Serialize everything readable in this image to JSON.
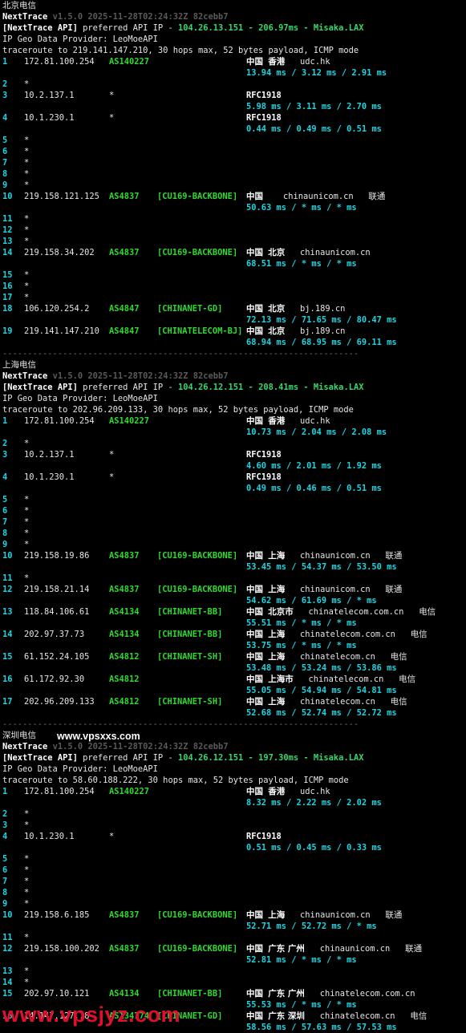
{
  "sections": [
    {
      "name": "北京电信",
      "version_line": {
        "tool": "NextTrace",
        "meta": "v1.5.0 2025-11-28T02:24:32Z 82cebb7"
      },
      "api_line": {
        "prefix": "[NextTrace API]",
        "mid": " preferred API IP - ",
        "ip": "104.26.13.151",
        "dash1": " - ",
        "latency": "206.97ms",
        "dash2": " - ",
        "node": "Misaka.LAX"
      },
      "geo_line": "IP Geo Data Provider: LeoMoeAPI",
      "trace_line": "traceroute to 219.141.147.210, 30 hops max, 52 bytes payload, ICMP mode",
      "rows": [
        {
          "hop": "1",
          "ip": "172.81.100.254",
          "asn": "AS140227",
          "tag": "",
          "country": "中国",
          "region": "香港",
          "city": "",
          "domain": "udc.hk",
          "isp": "",
          "times": "13.94 ms / 3.12 ms / 2.91 ms"
        },
        {
          "hop": "2",
          "ip": "*"
        },
        {
          "hop": "3",
          "ip": "10.2.137.1",
          "asn": "*",
          "tag": "",
          "country": "RFC1918",
          "times": "5.98 ms / 3.11 ms / 2.70 ms"
        },
        {
          "hop": "4",
          "ip": "10.1.230.1",
          "asn": "*",
          "tag": "",
          "country": "RFC1918",
          "times": "0.44 ms / 0.49 ms / 0.51 ms"
        },
        {
          "hop": "5",
          "ip": "*"
        },
        {
          "hop": "6",
          "ip": "*"
        },
        {
          "hop": "7",
          "ip": "*"
        },
        {
          "hop": "8",
          "ip": "*"
        },
        {
          "hop": "9",
          "ip": "*"
        },
        {
          "hop": "10",
          "ip": "219.158.121.125",
          "asn": "AS4837",
          "tag": "[CU169-BACKBONE]",
          "country": "中国",
          "region": "",
          "domain": "chinaunicom.cn",
          "isp": "联通",
          "times": "50.63 ms / * ms / * ms"
        },
        {
          "hop": "11",
          "ip": "*"
        },
        {
          "hop": "12",
          "ip": "*"
        },
        {
          "hop": "13",
          "ip": "*"
        },
        {
          "hop": "14",
          "ip": "219.158.34.202",
          "asn": "AS4837",
          "tag": "[CU169-BACKBONE]",
          "country": "中国",
          "region": "北京",
          "domain": "chinaunicom.cn",
          "isp": "",
          "times": "68.51 ms / * ms / * ms"
        },
        {
          "hop": "15",
          "ip": "*"
        },
        {
          "hop": "16",
          "ip": "*"
        },
        {
          "hop": "17",
          "ip": "*"
        },
        {
          "hop": "18",
          "ip": "106.120.254.2",
          "asn": "AS4847",
          "tag": "[CHINANET-GD]",
          "country": "中国",
          "region": "北京",
          "domain": "bj.189.cn",
          "isp": "",
          "times": "72.13 ms / 71.65 ms / 80.47 ms"
        },
        {
          "hop": "19",
          "ip": "219.141.147.210",
          "asn": "AS4847",
          "tag": "[CHINATELECOM-BJ]",
          "country": "中国",
          "region": "北京",
          "domain": "bj.189.cn",
          "isp": "",
          "times": "68.94 ms / 68.95 ms / 69.11 ms"
        }
      ]
    },
    {
      "name": "上海电信",
      "version_line": {
        "tool": "NextTrace",
        "meta": "v1.5.0 2025-11-28T02:24:32Z 82cebb7"
      },
      "api_line": {
        "prefix": "[NextTrace API]",
        "mid": " preferred API IP - ",
        "ip": "104.26.12.151",
        "dash1": " - ",
        "latency": "208.41ms",
        "dash2": " - ",
        "node": "Misaka.LAX"
      },
      "geo_line": "IP Geo Data Provider: LeoMoeAPI",
      "trace_line": "traceroute to 202.96.209.133, 30 hops max, 52 bytes payload, ICMP mode",
      "rows": [
        {
          "hop": "1",
          "ip": "172.81.100.254",
          "asn": "AS140227",
          "tag": "",
          "country": "中国",
          "region": "香港",
          "domain": "udc.hk",
          "isp": "",
          "times": "10.73 ms / 2.04 ms / 2.08 ms"
        },
        {
          "hop": "2",
          "ip": "*"
        },
        {
          "hop": "3",
          "ip": "10.2.137.1",
          "asn": "*",
          "tag": "",
          "country": "RFC1918",
          "times": "4.60 ms / 2.01 ms / 1.92 ms"
        },
        {
          "hop": "4",
          "ip": "10.1.230.1",
          "asn": "*",
          "tag": "",
          "country": "RFC1918",
          "times": "0.49 ms / 0.46 ms / 0.51 ms"
        },
        {
          "hop": "5",
          "ip": "*"
        },
        {
          "hop": "6",
          "ip": "*"
        },
        {
          "hop": "7",
          "ip": "*"
        },
        {
          "hop": "8",
          "ip": "*"
        },
        {
          "hop": "9",
          "ip": "*"
        },
        {
          "hop": "10",
          "ip": "219.158.19.86",
          "asn": "AS4837",
          "tag": "[CU169-BACKBONE]",
          "country": "中国",
          "region": "上海",
          "domain": "chinaunicom.cn",
          "isp": "联通",
          "times": "53.45 ms / 54.37 ms / 53.50 ms"
        },
        {
          "hop": "11",
          "ip": "*"
        },
        {
          "hop": "12",
          "ip": "219.158.21.14",
          "asn": "AS4837",
          "tag": "[CU169-BACKBONE]",
          "country": "中国",
          "region": "上海",
          "domain": "chinaunicom.cn",
          "isp": "联通",
          "times": "54.62 ms / 61.69 ms / * ms"
        },
        {
          "hop": "13",
          "ip": "118.84.106.61",
          "asn": "AS4134",
          "tag": "[CHINANET-BB]",
          "country": "中国",
          "region": "北京市",
          "domain": "chinatelecom.com.cn",
          "isp": "电信",
          "times": "55.51 ms / * ms / * ms"
        },
        {
          "hop": "14",
          "ip": "202.97.37.73",
          "asn": "AS4134",
          "tag": "[CHINANET-BB]",
          "country": "中国",
          "region": "上海",
          "domain": "chinatelecom.com.cn",
          "isp": "电信",
          "times": "53.75 ms / * ms / * ms"
        },
        {
          "hop": "15",
          "ip": "61.152.24.105",
          "asn": "AS4812",
          "tag": "[CHINANET-SH]",
          "country": "中国",
          "region": "上海",
          "domain": "chinatelecom.cn",
          "isp": "电信",
          "times": "53.48 ms / 53.24 ms / 53.86 ms"
        },
        {
          "hop": "16",
          "ip": "61.172.92.30",
          "asn": "AS4812",
          "tag": "",
          "country": "中国",
          "region": "上海市",
          "domain": "chinatelecom.cn",
          "isp": "电信",
          "times": "55.05 ms / 54.94 ms / 54.81 ms"
        },
        {
          "hop": "17",
          "ip": "202.96.209.133",
          "asn": "AS4812",
          "tag": "[CHINANET-SH]",
          "country": "中国",
          "region": "上海",
          "domain": "chinatelecom.cn",
          "isp": "电信",
          "times": "52.68 ms / 52.74 ms / 52.72 ms"
        }
      ]
    },
    {
      "name": "深圳电信",
      "version_line": {
        "tool": "NextTrace",
        "meta": "v1.5.0 2025-11-28T02:24:32Z 82cebb7"
      },
      "api_line": {
        "prefix": "[NextTrace API]",
        "mid": " preferred API IP - ",
        "ip": "104.26.12.151",
        "dash1": " - ",
        "latency": "197.30ms",
        "dash2": " - ",
        "node": "Misaka.LAX"
      },
      "geo_line": "IP Geo Data Provider: LeoMoeAPI",
      "trace_line": "traceroute to 58.60.188.222, 30 hops max, 52 bytes payload, ICMP mode",
      "rows": [
        {
          "hop": "1",
          "ip": "172.81.100.254",
          "asn": "AS140227",
          "tag": "",
          "country": "中国",
          "region": "香港",
          "domain": "udc.hk",
          "isp": "",
          "times": "8.32 ms / 2.22 ms / 2.02 ms"
        },
        {
          "hop": "2",
          "ip": "*"
        },
        {
          "hop": "3",
          "ip": "*"
        },
        {
          "hop": "4",
          "ip": "10.1.230.1",
          "asn": "*",
          "tag": "",
          "country": "RFC1918",
          "times": "0.51 ms / 0.45 ms / 0.33 ms"
        },
        {
          "hop": "5",
          "ip": "*"
        },
        {
          "hop": "6",
          "ip": "*"
        },
        {
          "hop": "7",
          "ip": "*"
        },
        {
          "hop": "8",
          "ip": "*"
        },
        {
          "hop": "9",
          "ip": "*"
        },
        {
          "hop": "10",
          "ip": "219.158.6.185",
          "asn": "AS4837",
          "tag": "[CU169-BACKBONE]",
          "country": "中国",
          "region": "上海",
          "domain": "chinaunicom.cn",
          "isp": "联通",
          "times": "52.71 ms / 52.72 ms / * ms"
        },
        {
          "hop": "11",
          "ip": "*"
        },
        {
          "hop": "12",
          "ip": "219.158.100.202",
          "asn": "AS4837",
          "tag": "[CU169-BACKBONE]",
          "country": "中国",
          "region": "广东 广州",
          "domain": "chinaunicom.cn",
          "isp": "联通",
          "times": "52.81 ms / * ms / * ms"
        },
        {
          "hop": "13",
          "ip": "*"
        },
        {
          "hop": "14",
          "ip": "*"
        },
        {
          "hop": "15",
          "ip": "202.97.10.121",
          "asn": "AS4134",
          "tag": "[CHINANET-BB]",
          "country": "中国",
          "region": "广东 广州",
          "domain": "chinatelecom.com.cn",
          "isp": "",
          "times": "55.53 ms / * ms / * ms"
        },
        {
          "hop": "16",
          "ip": "14.147.127.78",
          "asn": "AS134774",
          "tag": "[CHINANET-GD]",
          "country": "中国",
          "region": "广东 深圳",
          "domain": "chinatelecom.cn",
          "isp": "电信",
          "times": "58.56 ms / 57.63 ms / 57.53 ms"
        }
      ]
    }
  ],
  "separator": "-----------------------------------------------------------------------",
  "site_label": "www.vpsxxs.com",
  "watermark": "www.vpsjyz.com"
}
